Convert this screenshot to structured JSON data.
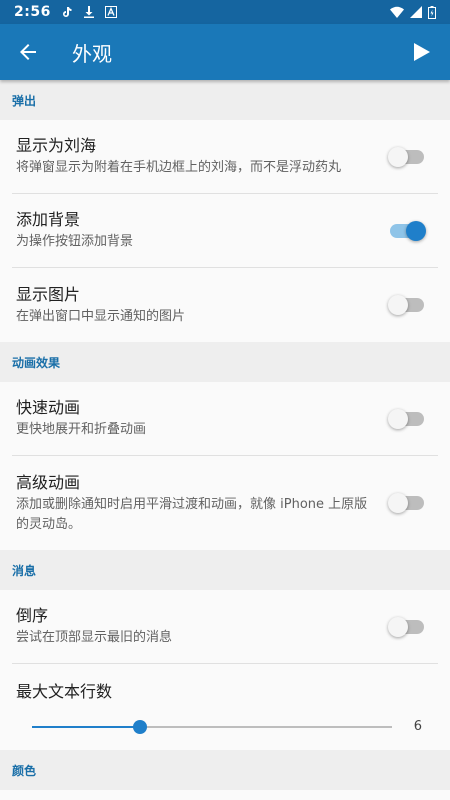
{
  "status_bar": {
    "time": "2:56"
  },
  "app_bar": {
    "title": "外观"
  },
  "sections": [
    {
      "header": "弹出",
      "items": [
        {
          "title": "显示为刘海",
          "subtitle": "将弹窗显示为附着在手机边框上的刘海，而不是浮动药丸",
          "enabled": false
        },
        {
          "title": "添加背景",
          "subtitle": "为操作按钮添加背景",
          "enabled": true
        },
        {
          "title": "显示图片",
          "subtitle": "在弹出窗口中显示通知的图片",
          "enabled": false
        }
      ]
    },
    {
      "header": "动画效果",
      "items": [
        {
          "title": "快速动画",
          "subtitle": "更快地展开和折叠动画",
          "enabled": false
        },
        {
          "title": "高级动画",
          "subtitle": "添加或删除通知时启用平滑过渡和动画，就像 iPhone 上原版的灵动岛。",
          "enabled": false
        }
      ]
    },
    {
      "header": "消息",
      "items": [
        {
          "title": "倒序",
          "subtitle": "尝试在顶部显示最旧的消息",
          "enabled": false
        }
      ],
      "slider": {
        "title": "最大文本行数",
        "value": "6",
        "fraction": 0.3
      }
    },
    {
      "header": "颜色",
      "items": []
    }
  ],
  "colors": {
    "app_bar": "#1a78b8",
    "status_bar": "#1565a0",
    "accent": "#1f7fca"
  }
}
